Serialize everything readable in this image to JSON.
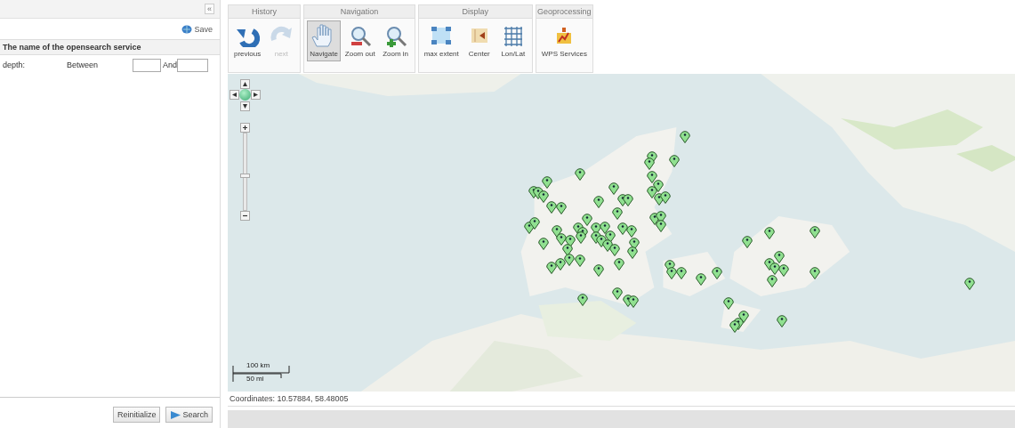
{
  "left_panel": {
    "collapse": "«",
    "save_button": "Save",
    "section_title": "The name of the opensearch service",
    "fields": [
      {
        "label": "depth:",
        "from_label": "Between",
        "to_label": "And"
      }
    ],
    "buttons": [
      {
        "label": "Reinitialize",
        "kind": "plain"
      },
      {
        "label": "Search",
        "kind": "search"
      }
    ]
  },
  "toolbar": {
    "groups": [
      {
        "title": "History",
        "buttons": [
          {
            "label": "previous",
            "kind": "undo",
            "selected": false,
            "disabled": false
          },
          {
            "label": "next",
            "kind": "redo",
            "selected": false,
            "disabled": true
          }
        ]
      },
      {
        "title": "Navigation",
        "buttons": [
          {
            "label": "Navigate",
            "kind": "hand",
            "selected": true,
            "disabled": false
          },
          {
            "label": "Zoom out",
            "kind": "zoomout",
            "selected": false,
            "disabled": false
          },
          {
            "label": "Zoom in",
            "kind": "zoomin",
            "selected": false,
            "disabled": false
          }
        ]
      },
      {
        "title": "Display",
        "buttons": [
          {
            "label": "max extent",
            "kind": "extent",
            "selected": false,
            "disabled": false
          },
          {
            "label": "Center",
            "kind": "center",
            "selected": false,
            "disabled": false
          },
          {
            "label": "Lon/Lat",
            "kind": "grid",
            "selected": false,
            "disabled": false
          }
        ]
      },
      {
        "title": "Geoprocessing",
        "buttons": [
          {
            "label": "WPS Services",
            "kind": "wps",
            "selected": false,
            "disabled": false
          }
        ]
      }
    ]
  },
  "map": {
    "kind": "picture",
    "zoom_slider": {
      "level": 0.45
    },
    "scale": {
      "km": "100 km",
      "mi": "50 mi"
    }
  },
  "status_bar": {
    "coordinates": "Coordinates: 10.57884, 58.48005"
  }
}
